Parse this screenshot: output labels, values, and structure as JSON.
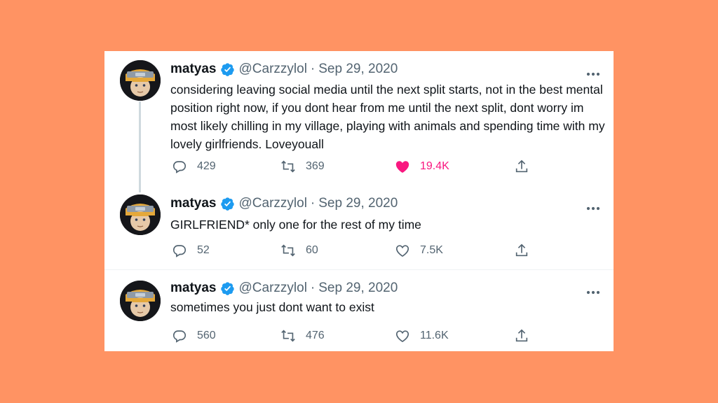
{
  "tweets": [
    {
      "name": "matyas",
      "handle": "@Carzzylol",
      "separator": "·",
      "date": "Sep 29, 2020",
      "text": "considering leaving social media until the next split starts, not in the best mental position right now, if you dont hear from me until the next split, dont worry im most likely chilling in my village, playing with animals and spending time with my lovely girlfriends. Loveyouall",
      "replies": "429",
      "retweets": "369",
      "likes": "19.4K",
      "liked": true
    },
    {
      "name": "matyas",
      "handle": "@Carzzylol",
      "separator": "·",
      "date": "Sep 29, 2020",
      "text": "GIRLFRIEND* only one for the rest of my time",
      "replies": "52",
      "retweets": "60",
      "likes": "7.5K",
      "liked": false
    },
    {
      "name": "matyas",
      "handle": "@Carzzylol",
      "separator": "·",
      "date": "Sep 29, 2020",
      "text": "sometimes you just dont want to exist",
      "replies": "560",
      "retweets": "476",
      "likes": "11.6K",
      "liked": false
    }
  ],
  "colors": {
    "background": "#FF9363",
    "card": "#FFFFFF",
    "verified": "#1D9BF0",
    "like_active": "#F91880",
    "muted": "#536471"
  },
  "icons": [
    "verified-badge-icon",
    "more-icon",
    "reply-icon",
    "retweet-icon",
    "like-icon",
    "share-icon"
  ]
}
